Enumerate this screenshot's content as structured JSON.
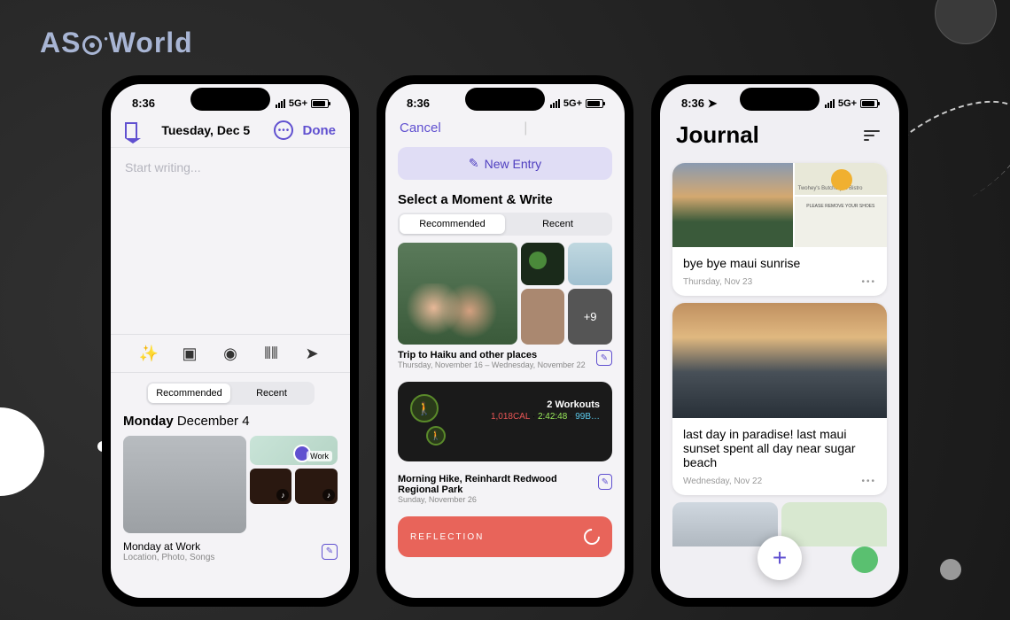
{
  "brand": "ASO World",
  "status": {
    "time": "8:36",
    "network": "5G+"
  },
  "phone1": {
    "date": "Tuesday, Dec 5",
    "done": "Done",
    "placeholder": "Start writing...",
    "tabs": {
      "recommended": "Recommended",
      "recent": "Recent"
    },
    "day_label_bold": "Monday",
    "day_label_rest": " December 4",
    "map_label": "Work",
    "moment_title": "Monday at Work",
    "moment_sub": "Location, Photo, Songs"
  },
  "phone2": {
    "cancel": "Cancel",
    "new_entry": "New Entry",
    "section": "Select a Moment & Write",
    "tabs": {
      "recommended": "Recommended",
      "recent": "Recent"
    },
    "more_count": "+9",
    "trip_title": "Trip to Haiku and other places",
    "trip_dates": "Thursday, November 16 – Wednesday, November 22",
    "workout": {
      "title": "2 Workouts",
      "cal": "1,018CAL",
      "time": "2:42:48",
      "dist": "99B…"
    },
    "hike_title": "Morning Hike, Reinhardt Redwood Regional Park",
    "hike_date": "Sunday, November 26",
    "reflection": "REFLECTION"
  },
  "phone3": {
    "title": "Journal",
    "map_place": "Twohey's Butchery & Bistro",
    "sign_text": "PLEASE REMOVE YOUR SHOES",
    "entry1_title": "bye bye maui sunrise",
    "entry1_date": "Thursday, Nov 23",
    "entry2_title": "last day in paradise! last maui sunset spent all day near sugar beach",
    "entry2_date": "Wednesday, Nov 22"
  }
}
